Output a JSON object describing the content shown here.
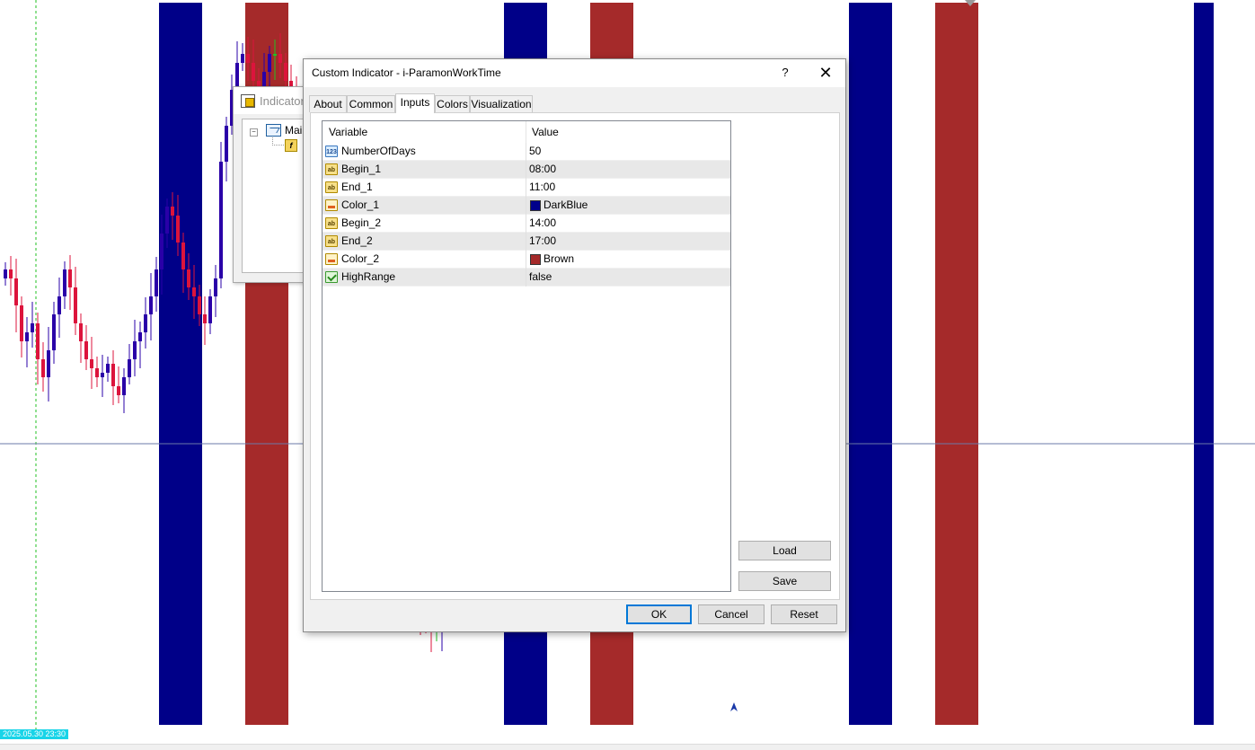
{
  "chart": {
    "time_label": "2025.05.30 23:30",
    "colors": {
      "band_1": "#000088",
      "band_2": "#a52a2a",
      "bull_candle": "#2a00a8",
      "bear_candle": "#dc143c",
      "doji": "#22c022",
      "hline": "#6b7aa8",
      "vline": "#22c022"
    }
  },
  "background_window": {
    "title": "Indicators",
    "tree_root": "Main"
  },
  "dialog": {
    "title": "Custom Indicator - i-ParamonWorkTime",
    "help": "?",
    "close": "✕",
    "tabs": [
      {
        "label": "About"
      },
      {
        "label": "Common"
      },
      {
        "label": "Inputs",
        "active": true
      },
      {
        "label": "Colors"
      },
      {
        "label": "Visualization"
      }
    ],
    "grid": {
      "col_variable": "Variable",
      "col_value": "Value",
      "rows": [
        {
          "icon": "num",
          "icon_text": "123",
          "name": "NumberOfDays",
          "value": "50"
        },
        {
          "icon": "str",
          "icon_text": "ab",
          "name": "Begin_1",
          "value": "08:00"
        },
        {
          "icon": "str",
          "icon_text": "ab",
          "name": "End_1",
          "value": "11:00"
        },
        {
          "icon": "col",
          "icon_text": "",
          "name": "Color_1",
          "value": "DarkBlue",
          "swatch": "#00008b"
        },
        {
          "icon": "str",
          "icon_text": "ab",
          "name": "Begin_2",
          "value": "14:00"
        },
        {
          "icon": "str",
          "icon_text": "ab",
          "name": "End_2",
          "value": "17:00"
        },
        {
          "icon": "col",
          "icon_text": "",
          "name": "Color_2",
          "value": "Brown",
          "swatch": "#a52a2a"
        },
        {
          "icon": "bool",
          "icon_text": "",
          "name": "HighRange",
          "value": "false"
        }
      ]
    },
    "buttons": {
      "load": "Load",
      "save": "Save",
      "ok": "OK",
      "cancel": "Cancel",
      "reset": "Reset"
    }
  }
}
